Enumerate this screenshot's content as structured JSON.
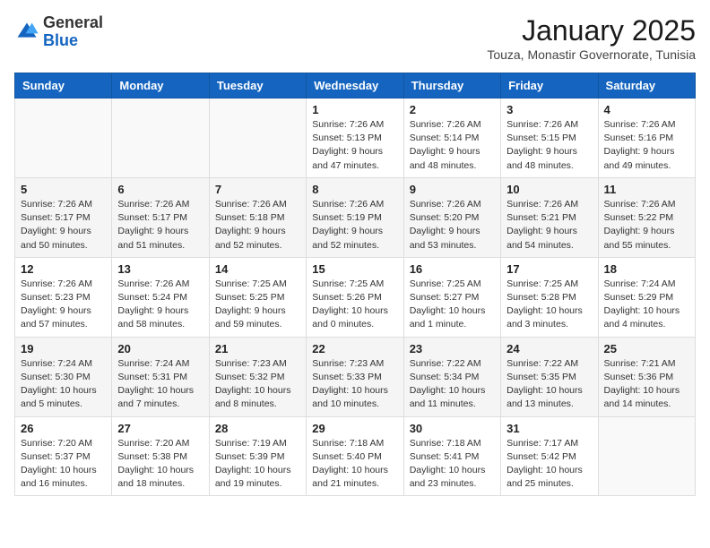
{
  "header": {
    "logo": {
      "general": "General",
      "blue": "Blue"
    },
    "title": "January 2025",
    "location": "Touza, Monastir Governorate, Tunisia"
  },
  "weekdays": [
    "Sunday",
    "Monday",
    "Tuesday",
    "Wednesday",
    "Thursday",
    "Friday",
    "Saturday"
  ],
  "weeks": [
    [
      {
        "day": "",
        "info": ""
      },
      {
        "day": "",
        "info": ""
      },
      {
        "day": "",
        "info": ""
      },
      {
        "day": "1",
        "info": "Sunrise: 7:26 AM\nSunset: 5:13 PM\nDaylight: 9 hours and 47 minutes."
      },
      {
        "day": "2",
        "info": "Sunrise: 7:26 AM\nSunset: 5:14 PM\nDaylight: 9 hours and 48 minutes."
      },
      {
        "day": "3",
        "info": "Sunrise: 7:26 AM\nSunset: 5:15 PM\nDaylight: 9 hours and 48 minutes."
      },
      {
        "day": "4",
        "info": "Sunrise: 7:26 AM\nSunset: 5:16 PM\nDaylight: 9 hours and 49 minutes."
      }
    ],
    [
      {
        "day": "5",
        "info": "Sunrise: 7:26 AM\nSunset: 5:17 PM\nDaylight: 9 hours and 50 minutes."
      },
      {
        "day": "6",
        "info": "Sunrise: 7:26 AM\nSunset: 5:17 PM\nDaylight: 9 hours and 51 minutes."
      },
      {
        "day": "7",
        "info": "Sunrise: 7:26 AM\nSunset: 5:18 PM\nDaylight: 9 hours and 52 minutes."
      },
      {
        "day": "8",
        "info": "Sunrise: 7:26 AM\nSunset: 5:19 PM\nDaylight: 9 hours and 52 minutes."
      },
      {
        "day": "9",
        "info": "Sunrise: 7:26 AM\nSunset: 5:20 PM\nDaylight: 9 hours and 53 minutes."
      },
      {
        "day": "10",
        "info": "Sunrise: 7:26 AM\nSunset: 5:21 PM\nDaylight: 9 hours and 54 minutes."
      },
      {
        "day": "11",
        "info": "Sunrise: 7:26 AM\nSunset: 5:22 PM\nDaylight: 9 hours and 55 minutes."
      }
    ],
    [
      {
        "day": "12",
        "info": "Sunrise: 7:26 AM\nSunset: 5:23 PM\nDaylight: 9 hours and 57 minutes."
      },
      {
        "day": "13",
        "info": "Sunrise: 7:26 AM\nSunset: 5:24 PM\nDaylight: 9 hours and 58 minutes."
      },
      {
        "day": "14",
        "info": "Sunrise: 7:25 AM\nSunset: 5:25 PM\nDaylight: 9 hours and 59 minutes."
      },
      {
        "day": "15",
        "info": "Sunrise: 7:25 AM\nSunset: 5:26 PM\nDaylight: 10 hours and 0 minutes."
      },
      {
        "day": "16",
        "info": "Sunrise: 7:25 AM\nSunset: 5:27 PM\nDaylight: 10 hours and 1 minute."
      },
      {
        "day": "17",
        "info": "Sunrise: 7:25 AM\nSunset: 5:28 PM\nDaylight: 10 hours and 3 minutes."
      },
      {
        "day": "18",
        "info": "Sunrise: 7:24 AM\nSunset: 5:29 PM\nDaylight: 10 hours and 4 minutes."
      }
    ],
    [
      {
        "day": "19",
        "info": "Sunrise: 7:24 AM\nSunset: 5:30 PM\nDaylight: 10 hours and 5 minutes."
      },
      {
        "day": "20",
        "info": "Sunrise: 7:24 AM\nSunset: 5:31 PM\nDaylight: 10 hours and 7 minutes."
      },
      {
        "day": "21",
        "info": "Sunrise: 7:23 AM\nSunset: 5:32 PM\nDaylight: 10 hours and 8 minutes."
      },
      {
        "day": "22",
        "info": "Sunrise: 7:23 AM\nSunset: 5:33 PM\nDaylight: 10 hours and 10 minutes."
      },
      {
        "day": "23",
        "info": "Sunrise: 7:22 AM\nSunset: 5:34 PM\nDaylight: 10 hours and 11 minutes."
      },
      {
        "day": "24",
        "info": "Sunrise: 7:22 AM\nSunset: 5:35 PM\nDaylight: 10 hours and 13 minutes."
      },
      {
        "day": "25",
        "info": "Sunrise: 7:21 AM\nSunset: 5:36 PM\nDaylight: 10 hours and 14 minutes."
      }
    ],
    [
      {
        "day": "26",
        "info": "Sunrise: 7:20 AM\nSunset: 5:37 PM\nDaylight: 10 hours and 16 minutes."
      },
      {
        "day": "27",
        "info": "Sunrise: 7:20 AM\nSunset: 5:38 PM\nDaylight: 10 hours and 18 minutes."
      },
      {
        "day": "28",
        "info": "Sunrise: 7:19 AM\nSunset: 5:39 PM\nDaylight: 10 hours and 19 minutes."
      },
      {
        "day": "29",
        "info": "Sunrise: 7:18 AM\nSunset: 5:40 PM\nDaylight: 10 hours and 21 minutes."
      },
      {
        "day": "30",
        "info": "Sunrise: 7:18 AM\nSunset: 5:41 PM\nDaylight: 10 hours and 23 minutes."
      },
      {
        "day": "31",
        "info": "Sunrise: 7:17 AM\nSunset: 5:42 PM\nDaylight: 10 hours and 25 minutes."
      },
      {
        "day": "",
        "info": ""
      }
    ]
  ]
}
